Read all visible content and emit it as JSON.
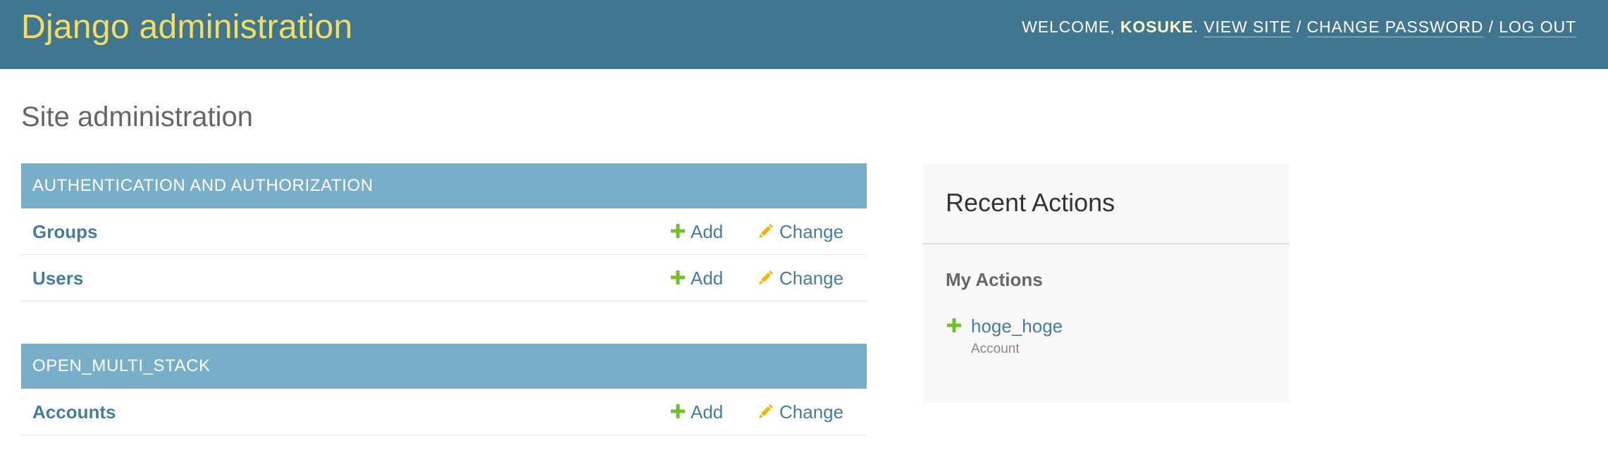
{
  "header": {
    "branding": "Django administration",
    "welcome": "WELCOME, ",
    "username": "KOSUKE",
    "period": ". ",
    "view_site": "VIEW SITE",
    "sep": " / ",
    "change_password": "CHANGE PASSWORD",
    "log_out": "LOG OUT"
  },
  "page_title": "Site administration",
  "apps": [
    {
      "caption": "AUTHENTICATION AND AUTHORIZATION",
      "models": [
        {
          "name": "Groups",
          "add": "Add",
          "change": "Change"
        },
        {
          "name": "Users",
          "add": "Add",
          "change": "Change"
        }
      ]
    },
    {
      "caption": "OPEN_MULTI_STACK",
      "models": [
        {
          "name": "Accounts",
          "add": "Add",
          "change": "Change"
        }
      ]
    }
  ],
  "recent": {
    "title": "Recent Actions",
    "my_actions": "My Actions",
    "items": [
      {
        "name": "hoge_hoge",
        "type": "Account",
        "icon": "plus-icon"
      }
    ]
  },
  "colors": {
    "header_bg": "#417690",
    "branding": "#f5dd5d",
    "caption_bg": "#79aec8",
    "link": "#447e9b",
    "add_icon": "#70bf2b",
    "change_icon": "#efb80b"
  }
}
